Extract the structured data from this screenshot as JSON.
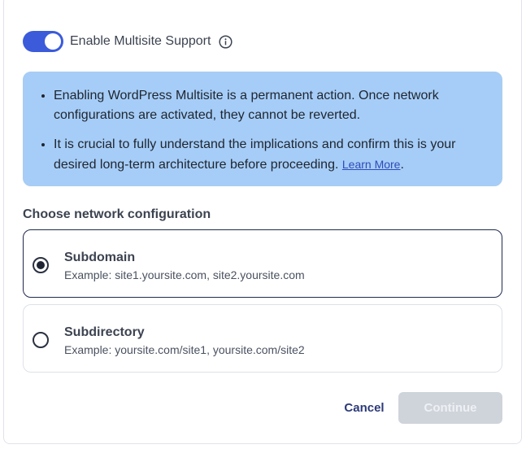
{
  "multisite": {
    "toggle_on": true,
    "label": "Enable Multisite Support",
    "info_icon": "info-circle-icon"
  },
  "notice": {
    "items": [
      "Enabling WordPress Multisite is a permanent action. Once network configurations are activated, they cannot be reverted.",
      "It is crucial to fully understand the implications and confirm this is your desired long-term architecture before proceeding."
    ],
    "link_text": "Learn More",
    "link_suffix": "."
  },
  "network": {
    "title": "Choose network configuration",
    "options": [
      {
        "label": "Subdomain",
        "example": "Example: site1.yoursite.com, site2.yoursite.com",
        "selected": true
      },
      {
        "label": "Subdirectory",
        "example": "Example: yoursite.com/site1, yoursite.com/site2",
        "selected": false
      }
    ]
  },
  "actions": {
    "cancel_label": "Cancel",
    "continue_label": "Continue"
  },
  "colors": {
    "toggle_on": "#3b5bdb",
    "notice_bg": "#a6cdf7",
    "link": "#2f4bb8",
    "selected_border": "#1f2b4d",
    "continue_disabled": "#cfd4db"
  }
}
